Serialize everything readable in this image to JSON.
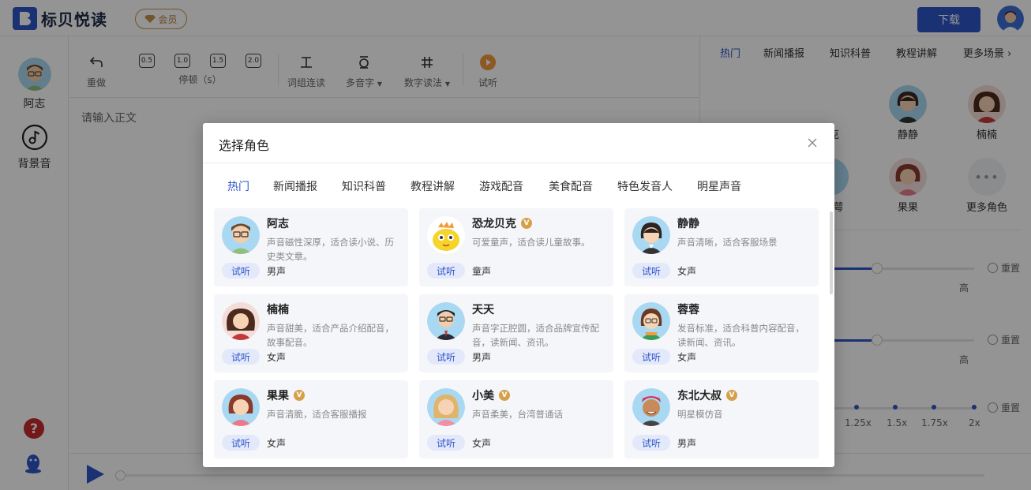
{
  "header": {
    "logo_text": "标贝悦读",
    "vip_label": "会员",
    "download_label": "下载"
  },
  "sidebar": {
    "anchor_label": "阿志",
    "bgm_label": "背景音"
  },
  "toolbar": {
    "undo_label": "重做",
    "pause_values": [
      "0.5",
      "1.0",
      "1.5",
      "2.0"
    ],
    "pause_label": "停顿（s）",
    "word_link_label": "词组连读",
    "polyphone_label": "多音字",
    "number_label": "数字读法",
    "listen_label": "试听"
  },
  "editor": {
    "placeholder": "请输入正文"
  },
  "right_panel": {
    "tabs": [
      "热门",
      "新闻播报",
      "知识科普",
      "教程讲解",
      "更多场景"
    ],
    "anchors": [
      "贝克",
      "静静",
      "楠楠",
      "萼",
      "果果",
      "更多角色"
    ],
    "high_label": "高",
    "reset_label": "重置",
    "speed_labels": [
      "1.25x",
      "1.5x",
      "1.75x",
      "2x"
    ]
  },
  "modal": {
    "title": "选择角色",
    "tabs": [
      "热门",
      "新闻播报",
      "知识科普",
      "教程讲解",
      "游戏配音",
      "美食配音",
      "特色发音人",
      "明星声音"
    ],
    "try_label": "试听",
    "vip_mark": "V",
    "cards": [
      {
        "name": "阿志",
        "vip": false,
        "desc": "声音磁性深厚，适合读小说、历史类文章。",
        "gender": "男声"
      },
      {
        "name": "恐龙贝克",
        "vip": true,
        "desc": "可爱童声，适合读儿童故事。",
        "gender": "童声"
      },
      {
        "name": "静静",
        "vip": false,
        "desc": "声音清晰，适合客服场景",
        "gender": "女声"
      },
      {
        "name": "楠楠",
        "vip": false,
        "desc": "声音甜美，适合产品介绍配音，故事配音。",
        "gender": "女声"
      },
      {
        "name": "天天",
        "vip": false,
        "desc": "声音字正腔圆，适合品牌宣传配音，读新闻、资讯。",
        "gender": "男声"
      },
      {
        "name": "蓉蓉",
        "vip": false,
        "desc": "发音标准，适合科普内容配音，读新闻、资讯。",
        "gender": "女声"
      },
      {
        "name": "果果",
        "vip": true,
        "desc": "声音清脆，适合客服播报",
        "gender": "女声"
      },
      {
        "name": "小美",
        "vip": true,
        "desc": "声音柔美，台湾普通话",
        "gender": "女声"
      },
      {
        "name": "东北大叔",
        "vip": true,
        "desc": "明星模仿音",
        "gender": "男声"
      }
    ]
  },
  "colors": {
    "accent": "#2d55c8",
    "vip_gold": "#d6a04a",
    "card_bg": "#f5f6f9",
    "overlay": "rgba(0,0,0,0.42)"
  }
}
